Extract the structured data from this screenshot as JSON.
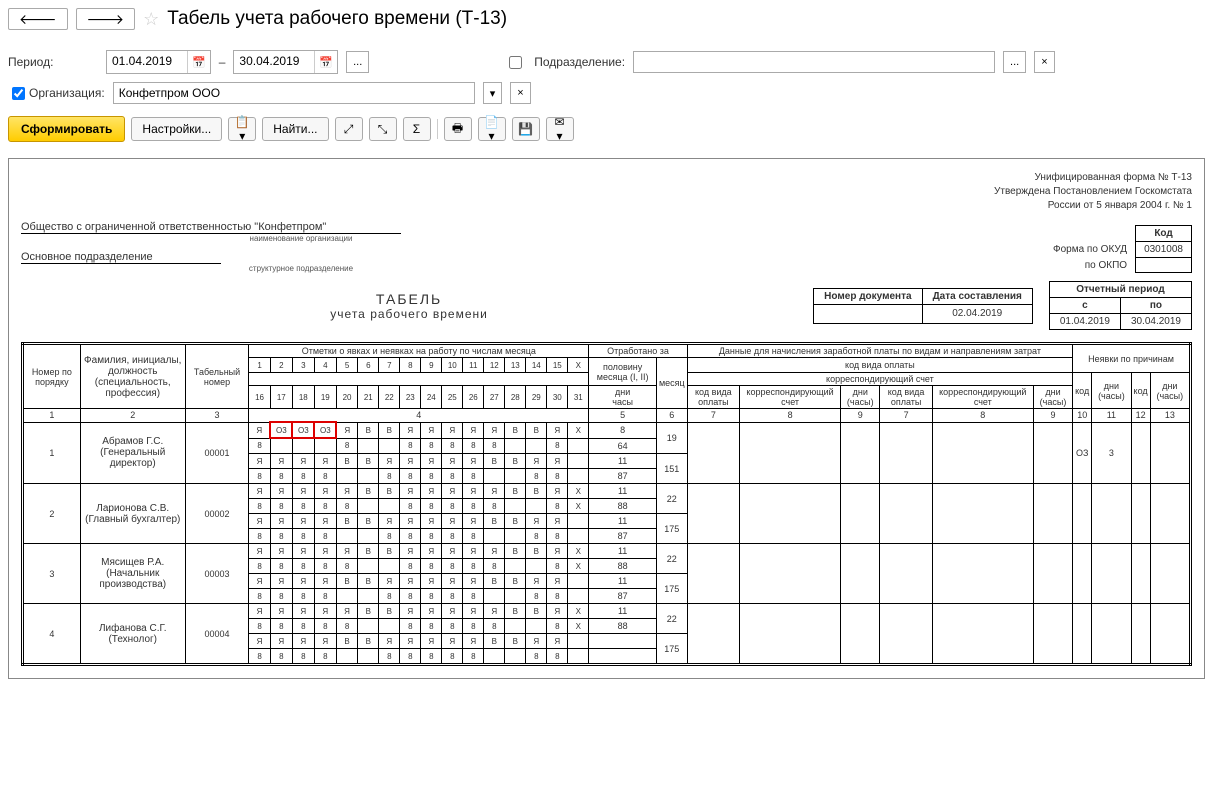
{
  "title": "Табель учета рабочего времени (Т-13)",
  "period": {
    "label": "Период:",
    "from": "01.04.2019",
    "to": "30.04.2019",
    "dash": "–"
  },
  "division": {
    "label": "Подразделение:",
    "value": ""
  },
  "org": {
    "label": "Организация:",
    "value": "Конфетпром ООО"
  },
  "toolbar": {
    "generate": "Сформировать",
    "settings": "Настройки...",
    "find": "Найти..."
  },
  "form_header": {
    "l1": "Унифицированная форма № Т-13",
    "l2": "Утверждена Постановлением Госкомстата",
    "l3": "России от 5 января 2004 г. № 1"
  },
  "codes": {
    "kod": "Код",
    "okud_label": "Форма по ОКУД",
    "okud": "0301008",
    "okpo_label": "по ОКПО",
    "okpo": ""
  },
  "company": "Общество с ограниченной ответственностью \"Конфетпром\"",
  "company_sub": "наименование организации",
  "main_div": "Основное подразделение",
  "main_div_sub": "структурное подразделение",
  "tabel": {
    "t1": "ТАБЕЛЬ",
    "t2": "учета  рабочего времени"
  },
  "doc": {
    "num_label": "Номер документа",
    "num": "",
    "date_label": "Дата составления",
    "date": "02.04.2019",
    "rep_label": "Отчетный период",
    "rep_from_l": "с",
    "rep_to_l": "по",
    "rep_from": "01.04.2019",
    "rep_to": "30.04.2019"
  },
  "th": {
    "num": "Номер по порядку",
    "fio": "Фамилия, инициалы, должность (специальность, профессия)",
    "tabnum": "Табельный номер",
    "marks": "Отметки о явках и неявках на работу по числам месяца",
    "half": "половину месяца (I, II)",
    "month": "месяц",
    "worked": "Отработано за",
    "days": "дни",
    "hours": "часы",
    "pay": "Данные для начисления заработной платы по видам и направлениям затрат",
    "paycode": "код вида оплаты",
    "corr": "корреспондирующий счет",
    "code": "код вида оплаты",
    "acc": "корреспондирующий счет",
    "dh": "дни (часы)",
    "abs": "Неявки по причинам",
    "abscode": "код",
    "absdh": "дни (часы)"
  },
  "colnums": [
    "1",
    "2",
    "3",
    "4",
    "5",
    "6",
    "7",
    "8",
    "9",
    "7",
    "8",
    "9",
    "10",
    "11",
    "12",
    "13"
  ],
  "days1": [
    "1",
    "2",
    "3",
    "4",
    "5",
    "6",
    "7",
    "8",
    "9",
    "10",
    "11",
    "12",
    "13",
    "14",
    "15",
    "X"
  ],
  "days2": [
    "16",
    "17",
    "18",
    "19",
    "20",
    "21",
    "22",
    "23",
    "24",
    "25",
    "26",
    "27",
    "28",
    "29",
    "30",
    "31"
  ],
  "employees": [
    {
      "n": "1",
      "name": "Абрамов Г.С. (Генеральный директор)",
      "tn": "00001",
      "r1": [
        "Я",
        "О3",
        "О3",
        "О3",
        "Я",
        "В",
        "В",
        "Я",
        "Я",
        "Я",
        "Я",
        "Я",
        "В",
        "В",
        "Я",
        "X"
      ],
      "h1": [
        "8",
        "",
        "",
        "",
        "8",
        "",
        "",
        "8",
        "8",
        "8",
        "8",
        "8",
        "",
        "",
        "8",
        ""
      ],
      "r2": [
        "Я",
        "Я",
        "Я",
        "Я",
        "В",
        "В",
        "Я",
        "Я",
        "Я",
        "Я",
        "Я",
        "В",
        "В",
        "Я",
        "Я",
        ""
      ],
      "h2": [
        "8",
        "8",
        "8",
        "8",
        "",
        "",
        "8",
        "8",
        "8",
        "8",
        "8",
        "",
        "",
        "8",
        "8",
        ""
      ],
      "half1d": "8",
      "half1h": "64",
      "half2d": "11",
      "half2h": "87",
      "md": "19",
      "mh": "151",
      "abs_code": "ОЗ",
      "abs_dh": "3"
    },
    {
      "n": "2",
      "name": "Ларионова С.В. (Главный бухгалтер)",
      "tn": "00002",
      "r1": [
        "Я",
        "Я",
        "Я",
        "Я",
        "Я",
        "В",
        "В",
        "Я",
        "Я",
        "Я",
        "Я",
        "Я",
        "В",
        "В",
        "Я",
        "X"
      ],
      "h1": [
        "8",
        "8",
        "8",
        "8",
        "8",
        "",
        "",
        "8",
        "8",
        "8",
        "8",
        "8",
        "",
        "",
        "8",
        "X"
      ],
      "r2": [
        "Я",
        "Я",
        "Я",
        "Я",
        "В",
        "В",
        "Я",
        "Я",
        "Я",
        "Я",
        "Я",
        "В",
        "В",
        "Я",
        "Я",
        ""
      ],
      "h2": [
        "8",
        "8",
        "8",
        "8",
        "",
        "",
        "8",
        "8",
        "8",
        "8",
        "8",
        "",
        "",
        "8",
        "8",
        ""
      ],
      "half1d": "11",
      "half1h": "88",
      "half2d": "11",
      "half2h": "87",
      "md": "22",
      "mh": "175",
      "abs_code": "",
      "abs_dh": ""
    },
    {
      "n": "3",
      "name": "Мясищев Р.А. (Начальник производства)",
      "tn": "00003",
      "r1": [
        "Я",
        "Я",
        "Я",
        "Я",
        "Я",
        "В",
        "В",
        "Я",
        "Я",
        "Я",
        "Я",
        "Я",
        "В",
        "В",
        "Я",
        "X"
      ],
      "h1": [
        "8",
        "8",
        "8",
        "8",
        "8",
        "",
        "",
        "8",
        "8",
        "8",
        "8",
        "8",
        "",
        "",
        "8",
        "X"
      ],
      "r2": [
        "Я",
        "Я",
        "Я",
        "Я",
        "В",
        "В",
        "Я",
        "Я",
        "Я",
        "Я",
        "Я",
        "В",
        "В",
        "Я",
        "Я",
        ""
      ],
      "h2": [
        "8",
        "8",
        "8",
        "8",
        "",
        "",
        "8",
        "8",
        "8",
        "8",
        "8",
        "",
        "",
        "8",
        "8",
        ""
      ],
      "half1d": "11",
      "half1h": "88",
      "half2d": "11",
      "half2h": "87",
      "md": "22",
      "mh": "175",
      "abs_code": "",
      "abs_dh": ""
    },
    {
      "n": "4",
      "name": "Лифанова С.Г. (Технолог)",
      "tn": "00004",
      "r1": [
        "Я",
        "Я",
        "Я",
        "Я",
        "Я",
        "В",
        "В",
        "Я",
        "Я",
        "Я",
        "Я",
        "Я",
        "В",
        "В",
        "Я",
        "X"
      ],
      "h1": [
        "8",
        "8",
        "8",
        "8",
        "8",
        "",
        "",
        "8",
        "8",
        "8",
        "8",
        "8",
        "",
        "",
        "8",
        "X"
      ],
      "r2": [
        "Я",
        "Я",
        "Я",
        "Я",
        "В",
        "В",
        "Я",
        "Я",
        "Я",
        "Я",
        "Я",
        "В",
        "В",
        "Я",
        "Я",
        ""
      ],
      "h2": [
        "8",
        "8",
        "8",
        "8",
        "",
        "",
        "8",
        "8",
        "8",
        "8",
        "8",
        "",
        "",
        "8",
        "8",
        ""
      ],
      "half1d": "11",
      "half1h": "88",
      "half2d": "",
      "half2h": "",
      "md": "22",
      "mh": "175",
      "abs_code": "",
      "abs_dh": ""
    }
  ]
}
